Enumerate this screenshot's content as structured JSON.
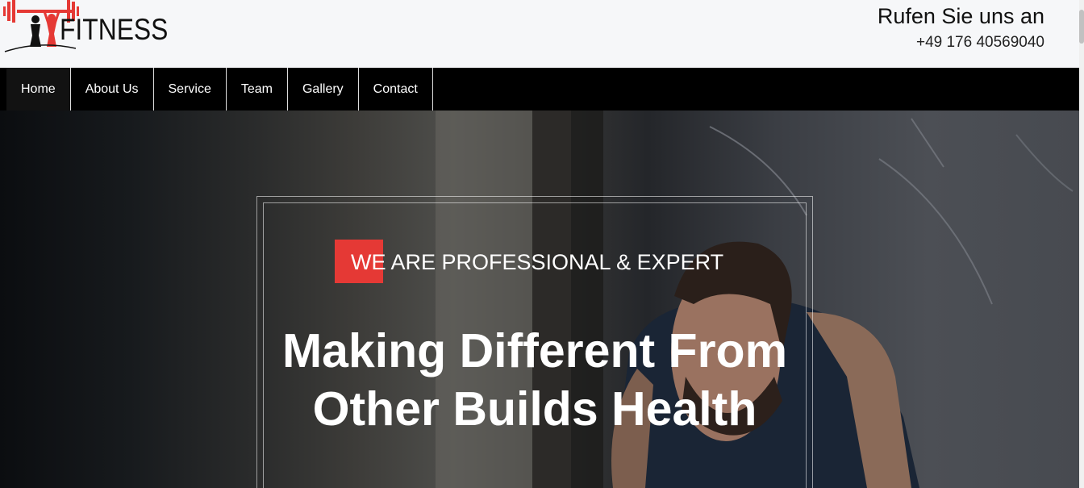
{
  "header": {
    "logo_text": "FITNESS",
    "call_title": "Rufen Sie uns an",
    "phone": "+49 176 40569040"
  },
  "nav": {
    "items": [
      {
        "label": "Home"
      },
      {
        "label": "About Us"
      },
      {
        "label": "Service"
      },
      {
        "label": "Team"
      },
      {
        "label": "Gallery"
      },
      {
        "label": "Contact"
      }
    ]
  },
  "hero": {
    "tagline": "WE ARE PROFESSIONAL & EXPERT",
    "headline": "Making Different From Other Builds Health"
  },
  "colors": {
    "accent": "#e53935",
    "nav_bg": "#000000",
    "header_bg": "#f6f7f9"
  }
}
